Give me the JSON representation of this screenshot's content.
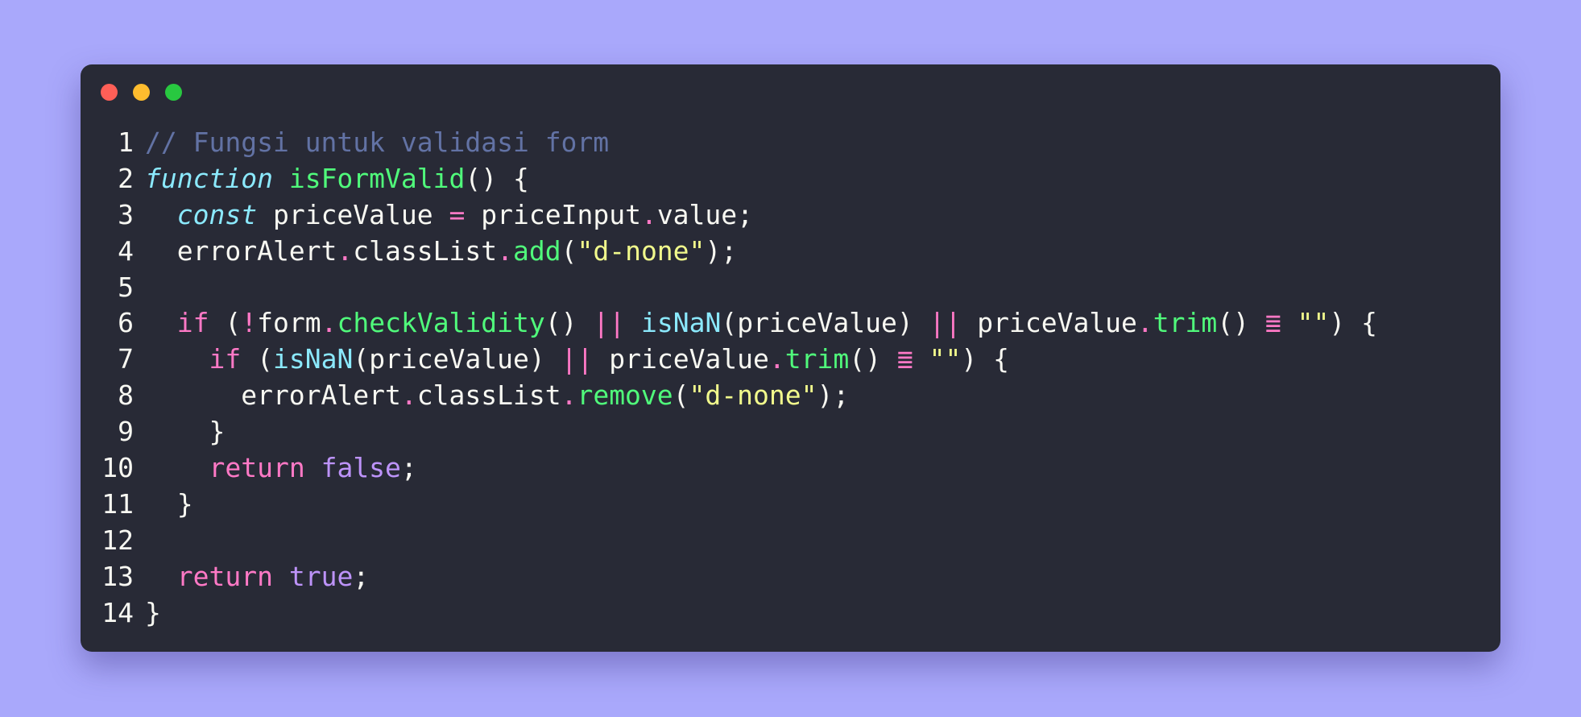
{
  "window": {
    "controls": {
      "close_color": "#ff5f57",
      "minimize_color": "#febc2e",
      "maximize_color": "#28c840"
    }
  },
  "colors": {
    "background": "#a9a8fb",
    "editor": "#282a36",
    "comment": "#6272a4",
    "storage": "#8be9fd",
    "function": "#50fa7b",
    "keyword": "#ff79c6",
    "string": "#f1fa8c",
    "constant": "#bd93f9",
    "text": "#f8f8f2"
  },
  "code": {
    "lines": [
      {
        "number": "1",
        "tokens": [
          {
            "t": "comment",
            "v": "// Fungsi untuk validasi form"
          }
        ]
      },
      {
        "number": "2",
        "tokens": [
          {
            "t": "storage",
            "v": "function"
          },
          {
            "t": "plain",
            "v": " "
          },
          {
            "t": "fn",
            "v": "isFormValid"
          },
          {
            "t": "plain",
            "v": "() {"
          }
        ]
      },
      {
        "number": "3",
        "tokens": [
          {
            "t": "plain",
            "v": "  "
          },
          {
            "t": "storage",
            "v": "const"
          },
          {
            "t": "plain",
            "v": " priceValue "
          },
          {
            "t": "op",
            "v": "="
          },
          {
            "t": "plain",
            "v": " priceInput"
          },
          {
            "t": "op",
            "v": "."
          },
          {
            "t": "plain",
            "v": "value;"
          }
        ]
      },
      {
        "number": "4",
        "tokens": [
          {
            "t": "plain",
            "v": "  errorAlert"
          },
          {
            "t": "op",
            "v": "."
          },
          {
            "t": "plain",
            "v": "classList"
          },
          {
            "t": "op",
            "v": "."
          },
          {
            "t": "fn",
            "v": "add"
          },
          {
            "t": "plain",
            "v": "("
          },
          {
            "t": "string",
            "v": "\"d-none\""
          },
          {
            "t": "plain",
            "v": ");"
          }
        ]
      },
      {
        "number": "5",
        "tokens": []
      },
      {
        "number": "6",
        "tokens": [
          {
            "t": "plain",
            "v": "  "
          },
          {
            "t": "keyword",
            "v": "if"
          },
          {
            "t": "plain",
            "v": " ("
          },
          {
            "t": "op",
            "v": "!"
          },
          {
            "t": "plain",
            "v": "form"
          },
          {
            "t": "op",
            "v": "."
          },
          {
            "t": "fn",
            "v": "checkValidity"
          },
          {
            "t": "plain",
            "v": "() "
          },
          {
            "t": "op",
            "v": "||"
          },
          {
            "t": "plain",
            "v": " "
          },
          {
            "t": "builtin",
            "v": "isNaN"
          },
          {
            "t": "plain",
            "v": "(priceValue) "
          },
          {
            "t": "op",
            "v": "||"
          },
          {
            "t": "plain",
            "v": " priceValue"
          },
          {
            "t": "op",
            "v": "."
          },
          {
            "t": "fn",
            "v": "trim"
          },
          {
            "t": "plain",
            "v": "() "
          },
          {
            "t": "op",
            "v": "≣"
          },
          {
            "t": "plain",
            "v": " "
          },
          {
            "t": "string",
            "v": "\"\""
          },
          {
            "t": "plain",
            "v": ") {"
          }
        ]
      },
      {
        "number": "7",
        "tokens": [
          {
            "t": "plain",
            "v": "    "
          },
          {
            "t": "keyword",
            "v": "if"
          },
          {
            "t": "plain",
            "v": " ("
          },
          {
            "t": "builtin",
            "v": "isNaN"
          },
          {
            "t": "plain",
            "v": "(priceValue) "
          },
          {
            "t": "op",
            "v": "||"
          },
          {
            "t": "plain",
            "v": " priceValue"
          },
          {
            "t": "op",
            "v": "."
          },
          {
            "t": "fn",
            "v": "trim"
          },
          {
            "t": "plain",
            "v": "() "
          },
          {
            "t": "op",
            "v": "≣"
          },
          {
            "t": "plain",
            "v": " "
          },
          {
            "t": "string",
            "v": "\"\""
          },
          {
            "t": "plain",
            "v": ") {"
          }
        ]
      },
      {
        "number": "8",
        "tokens": [
          {
            "t": "plain",
            "v": "      errorAlert"
          },
          {
            "t": "op",
            "v": "."
          },
          {
            "t": "plain",
            "v": "classList"
          },
          {
            "t": "op",
            "v": "."
          },
          {
            "t": "fn",
            "v": "remove"
          },
          {
            "t": "plain",
            "v": "("
          },
          {
            "t": "string",
            "v": "\"d-none\""
          },
          {
            "t": "plain",
            "v": ");"
          }
        ]
      },
      {
        "number": "9",
        "tokens": [
          {
            "t": "plain",
            "v": "    }"
          }
        ]
      },
      {
        "number": "10",
        "tokens": [
          {
            "t": "plain",
            "v": "    "
          },
          {
            "t": "keyword",
            "v": "return"
          },
          {
            "t": "plain",
            "v": " "
          },
          {
            "t": "const",
            "v": "false"
          },
          {
            "t": "plain",
            "v": ";"
          }
        ]
      },
      {
        "number": "11",
        "tokens": [
          {
            "t": "plain",
            "v": "  }"
          }
        ]
      },
      {
        "number": "12",
        "tokens": []
      },
      {
        "number": "13",
        "tokens": [
          {
            "t": "plain",
            "v": "  "
          },
          {
            "t": "keyword",
            "v": "return"
          },
          {
            "t": "plain",
            "v": " "
          },
          {
            "t": "const",
            "v": "true"
          },
          {
            "t": "plain",
            "v": ";"
          }
        ]
      },
      {
        "number": "14",
        "tokens": [
          {
            "t": "plain",
            "v": "}"
          }
        ]
      }
    ]
  }
}
